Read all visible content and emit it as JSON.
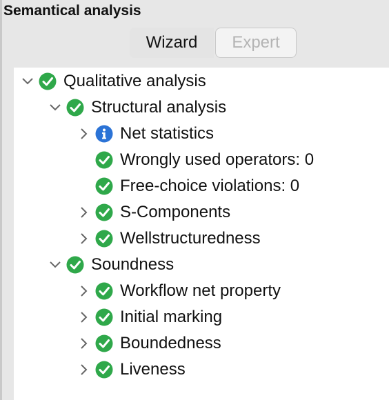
{
  "panel": {
    "title": "Semantical analysis"
  },
  "tabs": [
    {
      "label": "Wizard",
      "state": "selected"
    },
    {
      "label": "Expert",
      "state": "disabled"
    }
  ],
  "colors": {
    "ok": "#2fa84a",
    "info": "#2b73d6"
  },
  "tree": [
    {
      "label": "Qualitative analysis",
      "icon": "check-icon",
      "expand": "expanded"
    },
    {
      "label": "Structural analysis",
      "icon": "check-icon",
      "expand": "expanded"
    },
    {
      "label": "Net statistics",
      "icon": "info-icon",
      "expand": "collapsed"
    },
    {
      "label": "Wrongly used operators: 0",
      "icon": "check-icon",
      "expand": "none"
    },
    {
      "label": "Free-choice violations: 0",
      "icon": "check-icon",
      "expand": "none"
    },
    {
      "label": "S-Components",
      "icon": "check-icon",
      "expand": "collapsed"
    },
    {
      "label": "Wellstructuredness",
      "icon": "check-icon",
      "expand": "collapsed"
    },
    {
      "label": "Soundness",
      "icon": "check-icon",
      "expand": "expanded"
    },
    {
      "label": "Workflow net property",
      "icon": "check-icon",
      "expand": "collapsed"
    },
    {
      "label": "Initial marking",
      "icon": "check-icon",
      "expand": "collapsed"
    },
    {
      "label": "Boundedness",
      "icon": "check-icon",
      "expand": "collapsed"
    },
    {
      "label": "Liveness",
      "icon": "check-icon",
      "expand": "collapsed"
    }
  ]
}
